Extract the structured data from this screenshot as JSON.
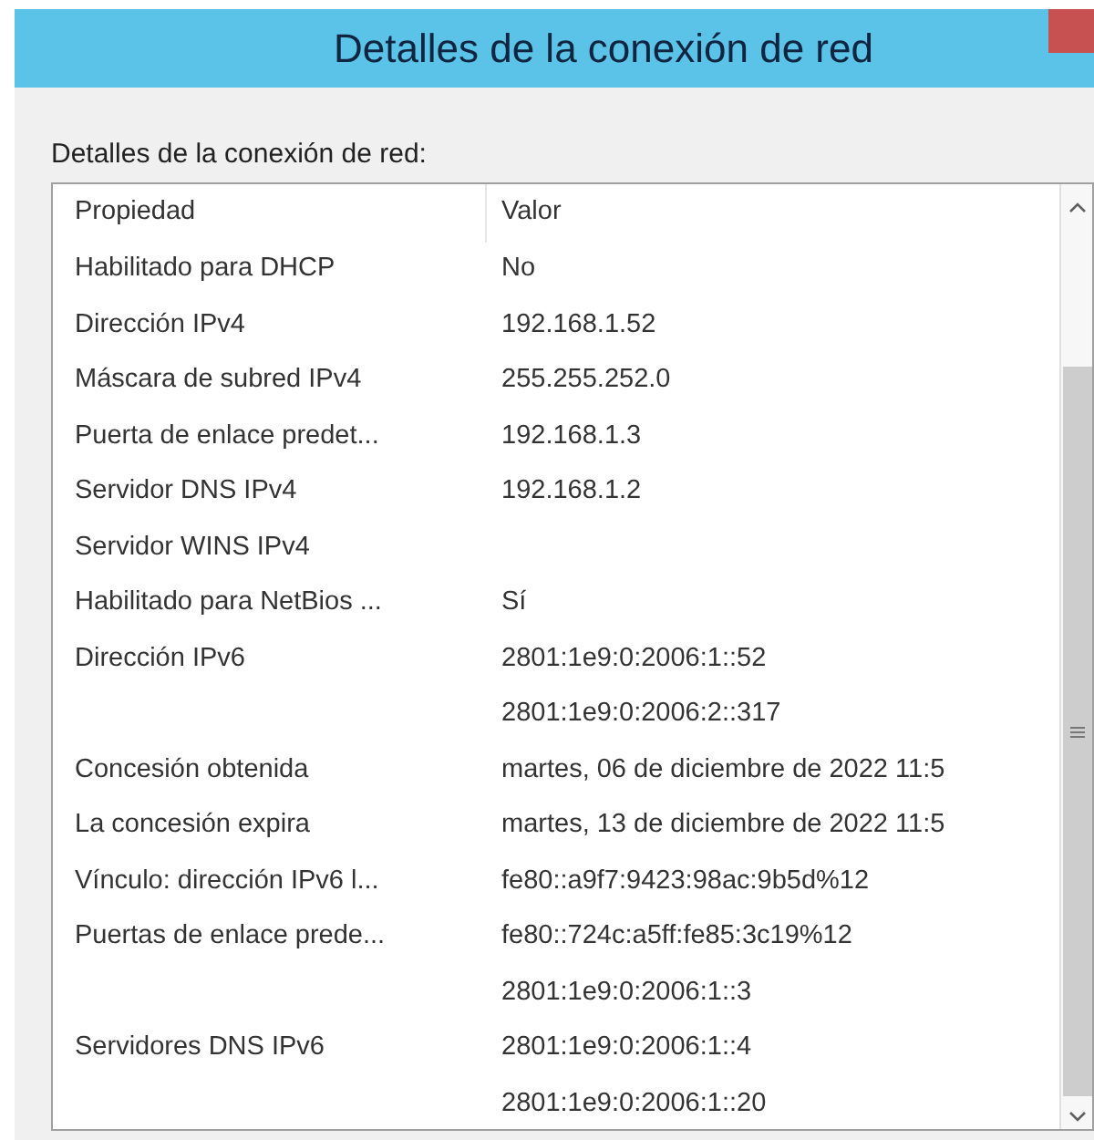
{
  "window": {
    "title": "Detalles de la conexión de red"
  },
  "label": "Detalles de la conexión de red:",
  "table": {
    "columns": [
      "Propiedad",
      "Valor"
    ],
    "rows": [
      {
        "property": "Habilitado para DHCP",
        "values": [
          "No"
        ]
      },
      {
        "property": "Dirección IPv4",
        "values": [
          "192.168.1.52"
        ]
      },
      {
        "property": "Máscara de subred IPv4",
        "values": [
          "255.255.252.0"
        ]
      },
      {
        "property": "Puerta de enlace predet...",
        "values": [
          "192.168.1.3"
        ]
      },
      {
        "property": "Servidor DNS IPv4",
        "values": [
          "192.168.1.2"
        ]
      },
      {
        "property": "Servidor WINS IPv4",
        "values": []
      },
      {
        "property": "Habilitado para NetBios ...",
        "values": [
          "Sí"
        ]
      },
      {
        "property": "Dirección IPv6",
        "values": [
          "2801:1e9:0:2006:1::52",
          "2801:1e9:0:2006:2::317"
        ]
      },
      {
        "property": "Concesión obtenida",
        "values": [
          "martes, 06 de diciembre de 2022 11:5"
        ]
      },
      {
        "property": "La concesión expira",
        "values": [
          "martes, 13 de diciembre de 2022 11:5"
        ]
      },
      {
        "property": "Vínculo: dirección IPv6 l...",
        "values": [
          "fe80::a9f7:9423:98ac:9b5d%12"
        ]
      },
      {
        "property": "Puertas de enlace prede...",
        "values": [
          "fe80::724c:a5ff:fe85:3c19%12",
          "2801:1e9:0:2006:1::3"
        ]
      },
      {
        "property": "Servidores DNS IPv6",
        "values": [
          "2801:1e9:0:2006:1::4",
          "2801:1e9:0:2006:1::20"
        ]
      }
    ]
  }
}
